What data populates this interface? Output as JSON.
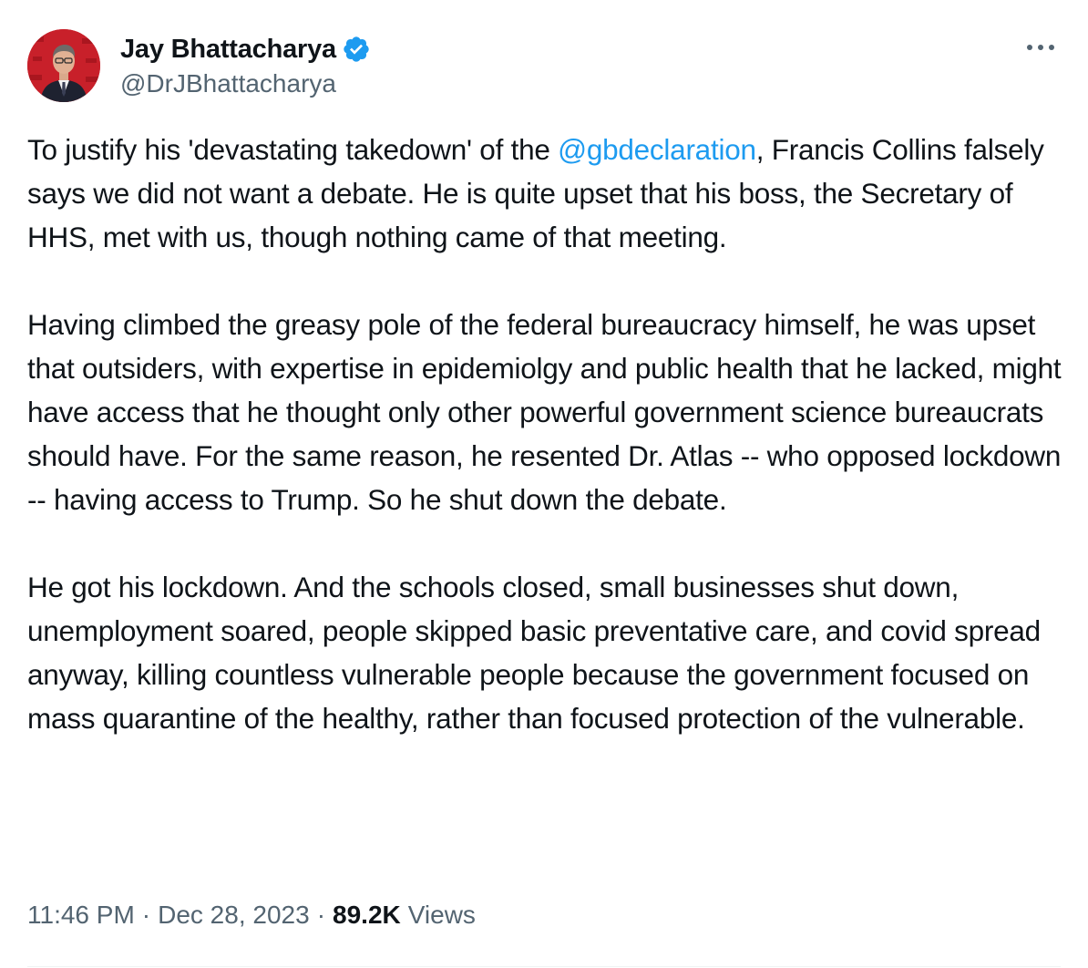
{
  "author": {
    "display_name": "Jay Bhattacharya",
    "handle": "@DrJBhattacharya",
    "avatar_icon": "profile-photo-avatar",
    "verified_icon": "verified-badge-icon"
  },
  "menu": {
    "more_icon": "more-options-icon"
  },
  "tweet": {
    "p1_before": "To justify his 'devastating takedown' of the ",
    "p1_mention": "@gbdeclaration",
    "p1_after": ", Francis Collins falsely says we did not want a debate. He is quite upset that his boss, the Secretary of HHS, met with us, though nothing came of that meeting.",
    "p2": "Having climbed the greasy pole of the federal bureaucracy himself, he was upset that outsiders, with expertise in epidemiolgy and public health that he lacked, might have access that he thought only other powerful government science bureaucrats should have. For the same reason, he resented Dr. Atlas -- who opposed lockdown -- having access to Trump. So he shut down the debate.",
    "p3": "He got his lockdown. And the schools closed, small businesses shut down, unemployment soared, people skipped basic preventative care, and covid spread anyway, killing countless vulnerable people because the government focused on mass quarantine of the healthy, rather than focused protection of the vulnerable."
  },
  "meta": {
    "time": "11:46 PM",
    "separator": "·",
    "date": "Dec 28, 2023",
    "views_count": "89.2K",
    "views_label": "Views"
  },
  "colors": {
    "text": "#0f1419",
    "secondary": "#536471",
    "link": "#1d9bf0",
    "verified": "#1d9bf0",
    "avatar_bg": "#c8202a"
  }
}
